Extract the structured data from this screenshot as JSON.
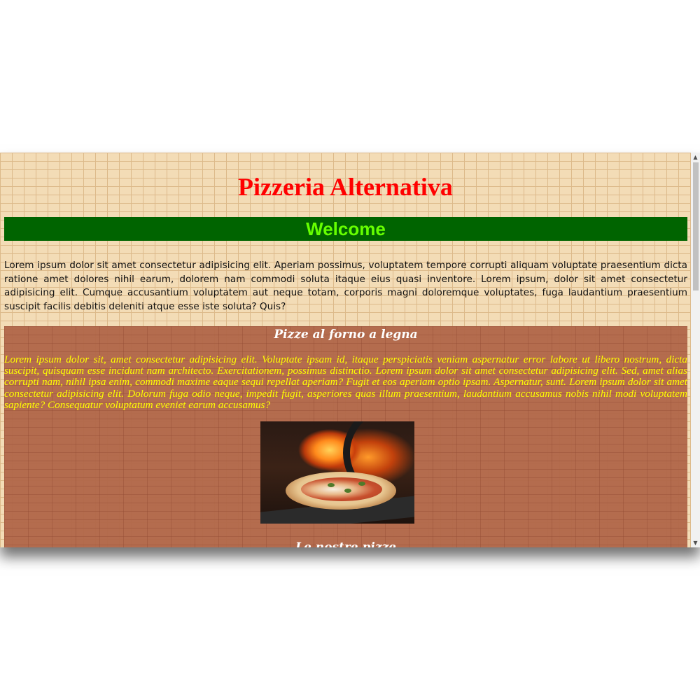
{
  "page": {
    "title": "Pizzeria Alternativa",
    "welcome": "Welcome",
    "intro": "Lorem ipsum dolor sit amet consectetur adipisicing elit. Aperiam possimus, voluptatem tempore corrupti aliquam voluptate praesentium dicta ratione amet dolores nihil earum, dolorem nam commodi soluta itaque eius quasi inventore. Lorem ipsum, dolor sit amet consectetur adipisicing elit. Cumque accusantium voluptatem aut neque totam, corporis magni doloremque voluptates, fuga laudantium praesentium suscipit facilis debitis deleniti atque esse iste soluta? Quis?"
  },
  "section": {
    "heading": "Pizze al forno a legna",
    "text": "Lorem ipsum dolor sit, amet consectetur adipisicing elit. Voluptate ipsam id, itaque perspiciatis veniam aspernatur error labore ut libero nostrum, dicta suscipit, quisquam esse incidunt nam architecto. Exercitationem, possimus distinctio. Lorem ipsum dolor sit amet consectetur adipisicing elit. Sed, amet alias corrupti nam, nihil ipsa enim, commodi maxime eaque sequi repellat aperiam? Fugit et eos aperiam optio ipsam. Aspernatur, sunt. Lorem ipsum dolor sit amet consectetur adipisicing elit. Dolorum fuga odio neque, impedit fugit, asperiores quas illum praesentium, laudantium accusamus nobis nihil modi voluptatem sapiente? Consequatur voluptatum eveniet earum accusamus?",
    "image_icon": "pizza-oven-photo",
    "subheading": "Le nostre pizze"
  },
  "colors": {
    "title": "#ff0000",
    "welcome_bg": "#006400",
    "welcome_text": "#66ff00",
    "section_text": "#ffff00",
    "section_bg": "#b2684a",
    "page_bg": "#f3dcb6"
  },
  "scrollbar": {
    "up_icon": "▲",
    "down_icon": "▼"
  }
}
